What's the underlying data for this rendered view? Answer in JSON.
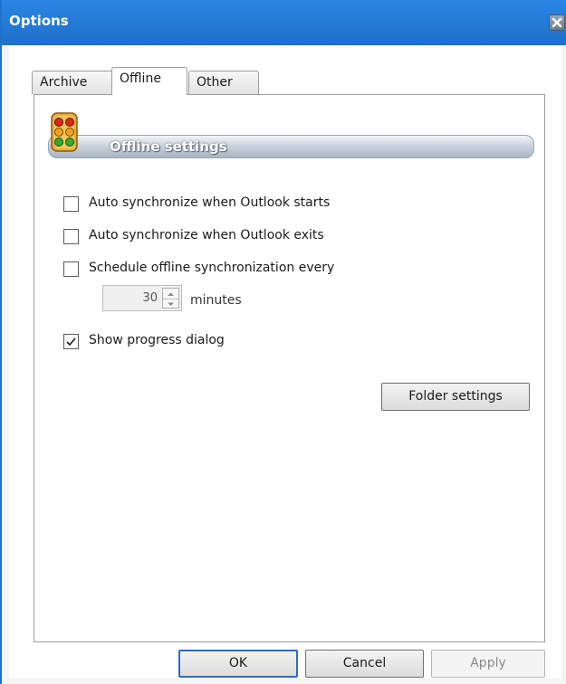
{
  "window": {
    "title": "Options"
  },
  "tabs": [
    {
      "label": "Archive",
      "active": false
    },
    {
      "label": "Offline",
      "active": true
    },
    {
      "label": "Other",
      "active": false
    }
  ],
  "section": {
    "title": "Offline settings",
    "icon": "traffic-light-icon"
  },
  "options": [
    {
      "label": "Auto synchronize when Outlook starts",
      "checked": false
    },
    {
      "label": "Auto synchronize when Outlook exits",
      "checked": false
    },
    {
      "label": "Schedule offline synchronization every",
      "checked": false
    },
    {
      "label": "Show progress dialog",
      "checked": true
    }
  ],
  "schedule": {
    "value": "30",
    "unit_label": "minutes",
    "enabled": false
  },
  "buttons": {
    "folder_settings": "Folder settings",
    "ok": "OK",
    "cancel": "Cancel",
    "apply": "Apply"
  },
  "colors": {
    "titlebar": "#1e6fc9",
    "accent": "#2b6cc4"
  }
}
